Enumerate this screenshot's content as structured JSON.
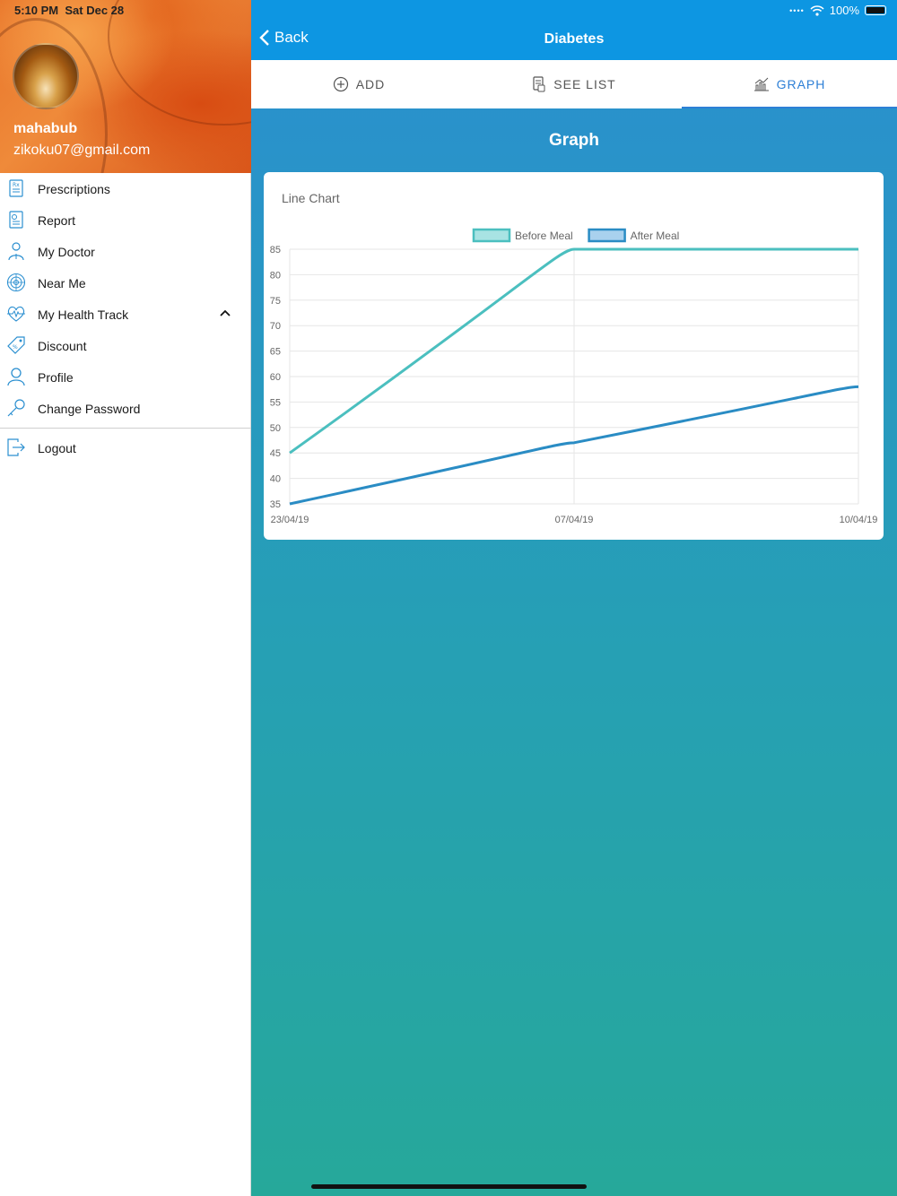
{
  "status_bar": {
    "time": "5:10 PM",
    "date": "Sat Dec 28",
    "battery": "100%"
  },
  "drawer": {
    "user_name": "mahabub",
    "user_email": "zikoku07@gmail.com",
    "items": [
      {
        "label": "Prescriptions",
        "icon": "prescription-icon"
      },
      {
        "label": "Report",
        "icon": "report-icon"
      },
      {
        "label": "My Doctor",
        "icon": "doctor-icon"
      },
      {
        "label": "Near Me",
        "icon": "radar-icon"
      },
      {
        "label": "My Health Track",
        "icon": "heartbeat-icon",
        "expanded": true
      },
      {
        "label": "Discount",
        "icon": "discount-tag-icon"
      },
      {
        "label": "Profile",
        "icon": "person-icon"
      },
      {
        "label": "Change Password",
        "icon": "key-icon"
      }
    ],
    "logout_label": "Logout"
  },
  "navbar": {
    "back_label": "Back",
    "title": "Diabetes"
  },
  "tabs": [
    {
      "label": "ADD",
      "icon": "add-circle-icon",
      "active": false
    },
    {
      "label": "SEE LIST",
      "icon": "list-document-icon",
      "active": false
    },
    {
      "label": "GRAPH",
      "icon": "chart-icon",
      "active": true
    }
  ],
  "section_title": "Graph",
  "colors": {
    "accent": "#2d7fd6",
    "navbar": "#0d96e2",
    "series_before": "#4bbfbf",
    "series_after": "#2a8cc4"
  },
  "chart_data": {
    "type": "line",
    "title": "Line Chart",
    "categories": [
      "23/04/19",
      "07/04/19",
      "10/04/19"
    ],
    "series": [
      {
        "name": "Before Meal",
        "values": [
          45,
          85,
          85
        ]
      },
      {
        "name": "After Meal",
        "values": [
          35,
          47,
          58
        ]
      }
    ],
    "ylim": [
      35,
      85
    ],
    "yticks": [
      85,
      80,
      75,
      70,
      65,
      60,
      55,
      50,
      45,
      40,
      35
    ],
    "grid": true,
    "legend": "top-center"
  }
}
